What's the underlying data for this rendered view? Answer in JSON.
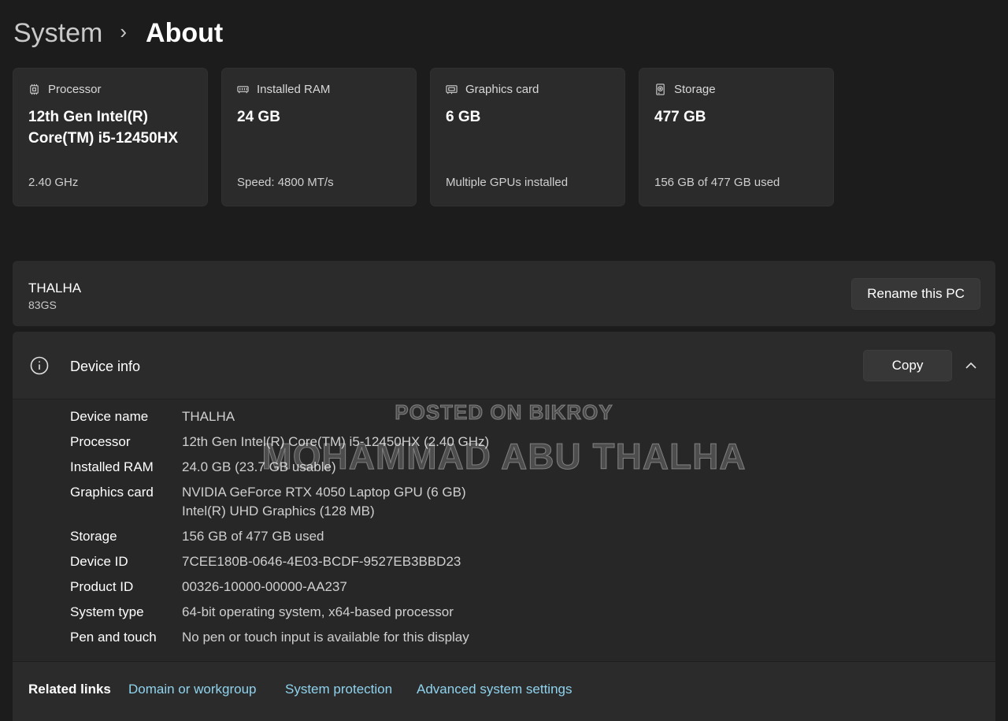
{
  "breadcrumb": {
    "parent": "System",
    "separator": "›",
    "current": "About"
  },
  "spec_cards": [
    {
      "icon": "processor-icon",
      "title": "Processor",
      "value": "12th Gen Intel(R) Core(TM) i5-12450HX",
      "sub": "2.40 GHz"
    },
    {
      "icon": "ram-icon",
      "title": "Installed RAM",
      "value": "24 GB",
      "sub": "Speed: 4800 MT/s"
    },
    {
      "icon": "graphics-card-icon",
      "title": "Graphics card",
      "value": "6 GB",
      "sub": "Multiple GPUs installed"
    },
    {
      "icon": "storage-icon",
      "title": "Storage",
      "value": "477 GB",
      "sub": "156 GB of 477 GB used"
    }
  ],
  "pc": {
    "name": "THALHA",
    "model": "83GS",
    "rename_label": "Rename this PC"
  },
  "device_info": {
    "title": "Device info",
    "copy_label": "Copy",
    "rows": [
      {
        "label": "Device name",
        "value": "THALHA"
      },
      {
        "label": "Processor",
        "value": "12th Gen Intel(R) Core(TM) i5-12450HX (2.40 GHz)"
      },
      {
        "label": "Installed RAM",
        "value": "24.0 GB (23.7 GB usable)"
      },
      {
        "label": "Graphics card",
        "value": "NVIDIA GeForce RTX 4050 Laptop GPU (6 GB)",
        "value2": "Intel(R) UHD Graphics (128 MB)"
      },
      {
        "label": "Storage",
        "value": "156 GB of 477 GB used"
      },
      {
        "label": "Device ID",
        "value": "7CEE180B-0646-4E03-BCDF-9527EB3BBD23"
      },
      {
        "label": "Product ID",
        "value": "00326-10000-00000-AA237"
      },
      {
        "label": "System type",
        "value": "64-bit operating system, x64-based processor"
      },
      {
        "label": "Pen and touch",
        "value": "No pen or touch input is available for this display"
      }
    ]
  },
  "related_links": {
    "label": "Related links",
    "links": [
      "Domain or workgroup",
      "System protection",
      "Advanced system settings"
    ]
  },
  "watermark": {
    "line1": "POSTED ON BIKROY",
    "line2": "MOHAMMAD ABU THALHA"
  },
  "colors": {
    "background": "#1c1c1c",
    "card": "#2b2b2b",
    "link": "#8fd3ee"
  }
}
